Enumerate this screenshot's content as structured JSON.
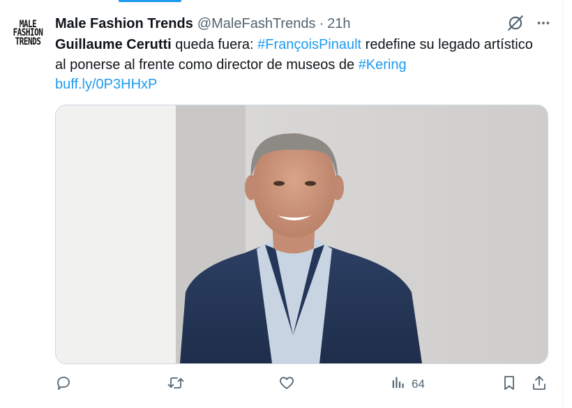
{
  "tweet": {
    "author": {
      "display_name": "Male Fashion Trends",
      "handle": "@MaleFashTrends",
      "separator": "·",
      "time": "21h",
      "avatar_lines": [
        "MALE",
        "FASHION",
        "TRENDS"
      ]
    },
    "text": {
      "mention_bold": "Guillaume Cerutti",
      "part1": " queda fuera: ",
      "hashtag1": "#FrançoisPinault",
      "part2": " redefine su legado artístico al ponerse al frente como director de museos de ",
      "hashtag2": "#Kering",
      "link": "buff.ly/0P3HHxP"
    },
    "actions": {
      "views_count": "64"
    },
    "icons": {
      "grok": "grok-icon",
      "more": "more-icon",
      "reply": "reply-icon",
      "retweet": "retweet-icon",
      "like": "like-icon",
      "views": "views-icon",
      "bookmark": "bookmark-icon",
      "share": "share-icon"
    },
    "colors": {
      "accent": "#1d9bf0",
      "secondary_text": "#536471",
      "primary_text": "#0f1419"
    }
  }
}
